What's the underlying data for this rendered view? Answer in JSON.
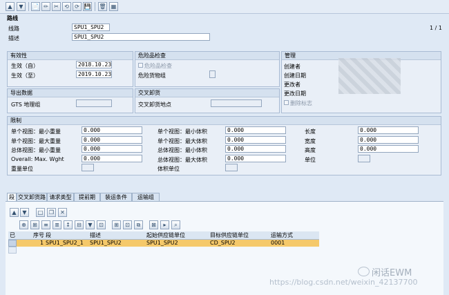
{
  "toolbar": {
    "buttons": [
      "▲",
      "▼",
      "📄",
      "✏",
      "✂",
      "⟲",
      "⟳",
      "💾",
      "🗑",
      "▦"
    ]
  },
  "header": {
    "title": "路线",
    "page_indicator": "1 / 1"
  },
  "route": {
    "route_label": "线路",
    "route_value": "SPU1_SPU2",
    "desc_label": "描述",
    "desc_value": "SPU1_SPU2"
  },
  "validity": {
    "title": "有效性",
    "from_label": "生效（自）",
    "from_value": "2018.10.23",
    "to_label": "生效（至）",
    "to_value": "2019.10.23"
  },
  "dangerous": {
    "title": "危险品检查",
    "check_label": "危险品检查",
    "goods_label": "危险货物组"
  },
  "management": {
    "title": "管理",
    "created_by": "创建者",
    "created_on": "创建日期",
    "changed_by": "更改者",
    "changed_on": "更改日期",
    "delete_flag": "删除标志"
  },
  "export": {
    "title": "导出数据",
    "gts_label": "GTS 地理组"
  },
  "crossdock": {
    "title": "交叉卸货",
    "location_label": "交叉卸货地点"
  },
  "limits": {
    "title": "限制",
    "col1": [
      {
        "label": "单个视图：最小重量",
        "value": "0.000"
      },
      {
        "label": "单个视图：最大重量",
        "value": "0.000"
      },
      {
        "label": "总体视图：最小重量",
        "value": "0.000"
      },
      {
        "label": "Overall: Max. Wght",
        "value": "0.000"
      },
      {
        "label": "重量单位",
        "value": ""
      }
    ],
    "col2": [
      {
        "label": "单个视图：最小体积",
        "value": "0.000"
      },
      {
        "label": "单个视图：最大体积",
        "value": "0.000"
      },
      {
        "label": "总体视图：最小体积",
        "value": "0.000"
      },
      {
        "label": "总体视图：最大体积",
        "value": "0.000"
      },
      {
        "label": "体积单位",
        "value": ""
      }
    ],
    "col3": [
      {
        "label": "长度",
        "value": "0.000"
      },
      {
        "label": "宽度",
        "value": "0.000"
      },
      {
        "label": "高度",
        "value": "0.000"
      },
      {
        "label": "单位",
        "value": ""
      }
    ]
  },
  "tabs": [
    "段",
    "交叉卸货路线",
    "请求类型",
    "提前期",
    "装运条件",
    "运输组"
  ],
  "grid": {
    "headers": [
      "已",
      "序号",
      "段",
      "描述",
      "起始供应链单位",
      "目标供应链单位",
      "运输方式"
    ],
    "rows": [
      {
        "seq": "1",
        "segment": "SPU1_SPU2_1",
        "desc": "SPU1_SPU2",
        "start": "SPU1_SPU2",
        "target": "CD_SPU2",
        "mode": "0001"
      }
    ]
  },
  "watermark": {
    "brand": "闲话EWM",
    "url": "https://blog.csdn.net/weixin_42137700"
  }
}
